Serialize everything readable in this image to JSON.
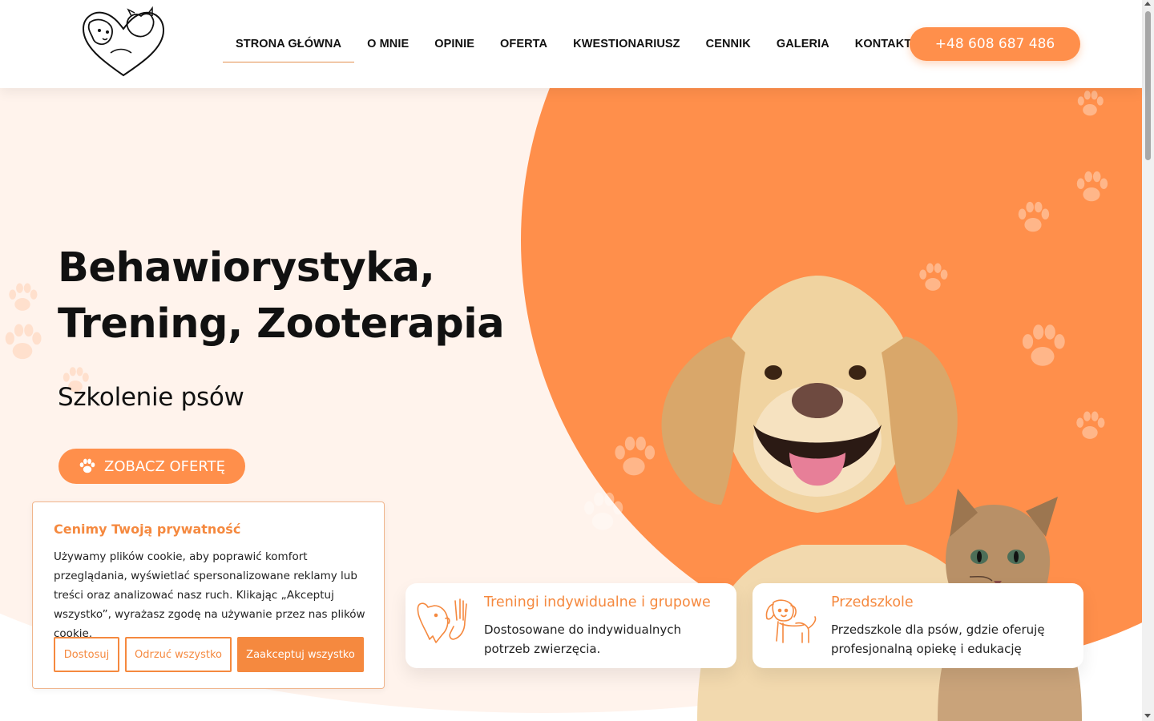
{
  "nav": {
    "items": [
      "STRONA GŁÓWNA",
      "O MNIE",
      "OPINIE",
      "OFERTA",
      "KWESTIONARIUSZ",
      "CENNIK",
      "GALERIA",
      "KONTAKT"
    ],
    "active_index": 0,
    "phone": "+48 608 687 486"
  },
  "hero": {
    "title_line1": "Behawiorystyka,",
    "title_line2": "Trening, Zooterapia",
    "subtitle": "Szkolenie psów",
    "cta_label": "ZOBACZ OFERTĘ",
    "cta_icon": "paw-icon"
  },
  "cards": [
    {
      "icon": "dog-hand-icon",
      "title": "Treningi indywidualne i grupowe",
      "desc": "Dostosowane do indywidualnych potrzeb zwierzęcia."
    },
    {
      "icon": "puppy-icon",
      "title": "Przedszkole",
      "desc": "Przedszkole dla psów, gdzie oferuję profesjonalną opiekę i edukację"
    }
  ],
  "cookie": {
    "title": "Cenimy Twoją prywatność",
    "text": "Używamy plików cookie, aby poprawić komfort przeglądania, wyświetlać spersonalizowane reklamy lub treści oraz analizować nasz ruch. Klikając „Akceptuj wszystko”, wyrażasz zgodę na używanie przez nas plików cookie.",
    "customize": "Dostosuj",
    "reject": "Odrzuć wszystko",
    "accept": "Zaakceptuj wszystko"
  },
  "colors": {
    "accent": "#ff8f4b",
    "hero_bg": "#fff3ec",
    "text": "#111111"
  }
}
